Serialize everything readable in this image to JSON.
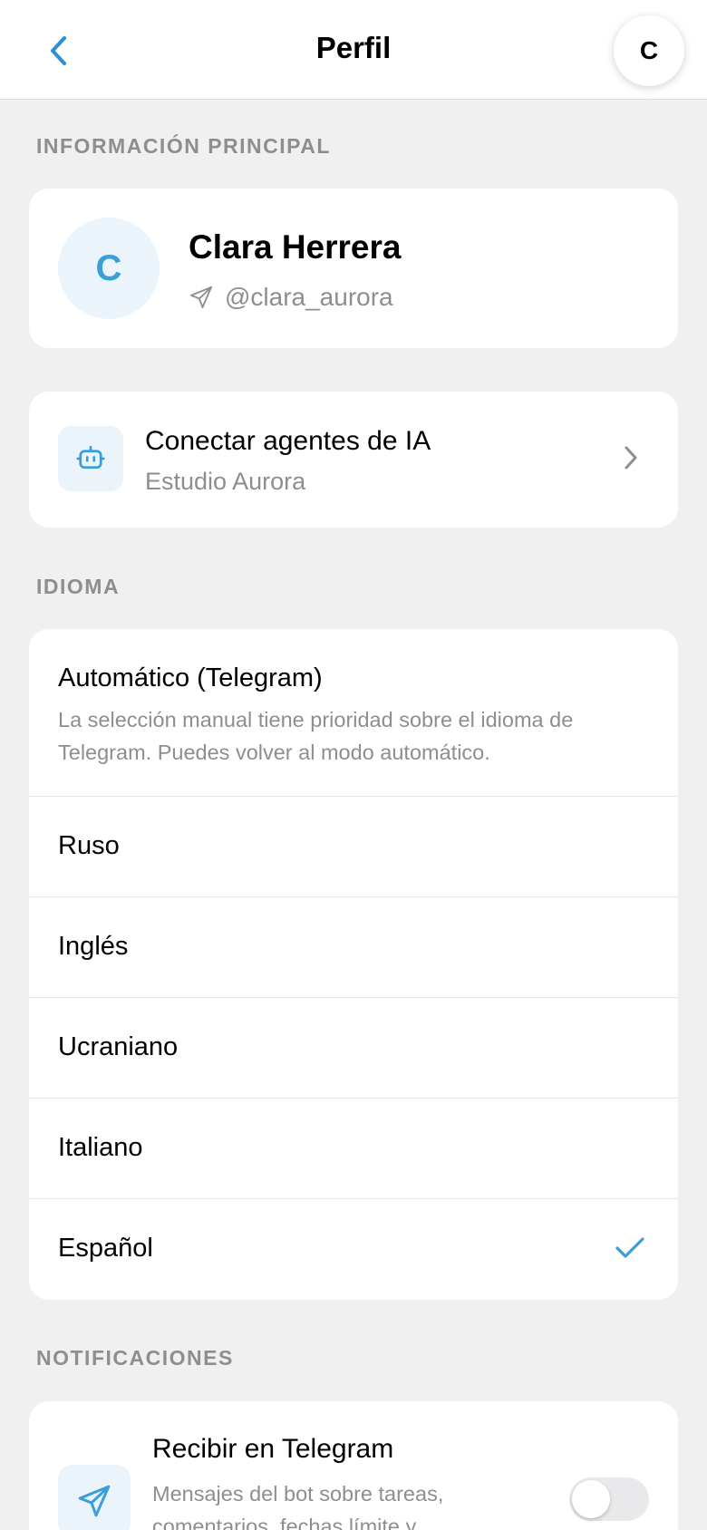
{
  "header": {
    "title": "Perfil",
    "avatar_initial": "C"
  },
  "sections": {
    "main_info": "INFORMACIÓN PRINCIPAL",
    "language": "IDIOMA",
    "notifications": "NOTIFICACIONES"
  },
  "profile": {
    "initial": "C",
    "name": "Clara Herrera",
    "handle": "@clara_aurora"
  },
  "agents": {
    "title": "Conectar agentes de IA",
    "subtitle": "Estudio Aurora"
  },
  "language": {
    "auto_title": "Automático (Telegram)",
    "auto_description": "La selección manual tiene prioridad sobre el idioma de Telegram. Puedes volver al modo automático.",
    "options": [
      {
        "label": "Ruso",
        "selected": false
      },
      {
        "label": "Inglés",
        "selected": false
      },
      {
        "label": "Ucraniano",
        "selected": false
      },
      {
        "label": "Italiano",
        "selected": false
      },
      {
        "label": "Español",
        "selected": true
      }
    ]
  },
  "notifications": {
    "title": "Recibir en Telegram",
    "description": "Mensajes del bot sobre tareas, comentarios, fechas límite y",
    "enabled": false
  },
  "colors": {
    "accent": "#3a9fd8",
    "muted_text": "#8e8e8e",
    "background": "#f0f0f0"
  }
}
